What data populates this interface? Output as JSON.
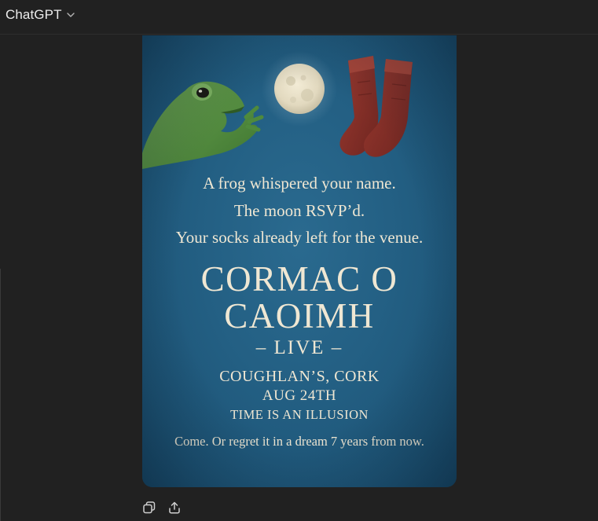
{
  "header": {
    "model_label": "ChatGPT"
  },
  "poster": {
    "tagline_lines": [
      "A frog whispered your name.",
      "The moon RSVP’d.",
      "Your socks already left for the venue."
    ],
    "artist_lines": [
      "CORMAC O",
      "CAOIMH"
    ],
    "live": "– LIVE –",
    "venue": "COUGHLAN’S, CORK",
    "date": "AUG 24TH",
    "time_line": "TIME IS AN ILLUSION",
    "closing": "Come. Or regret it in a dream 7 years from now.",
    "colors": {
      "background": "#235f83",
      "text": "#efe7d3",
      "frog": "#4f8a3c",
      "moon": "#e4dcc4",
      "socks": "#8a2f28"
    }
  },
  "actions": {
    "icons": [
      "copy-icon",
      "share-icon"
    ]
  },
  "theme": {
    "app_background": "#212121",
    "header_text": "#ececec"
  }
}
